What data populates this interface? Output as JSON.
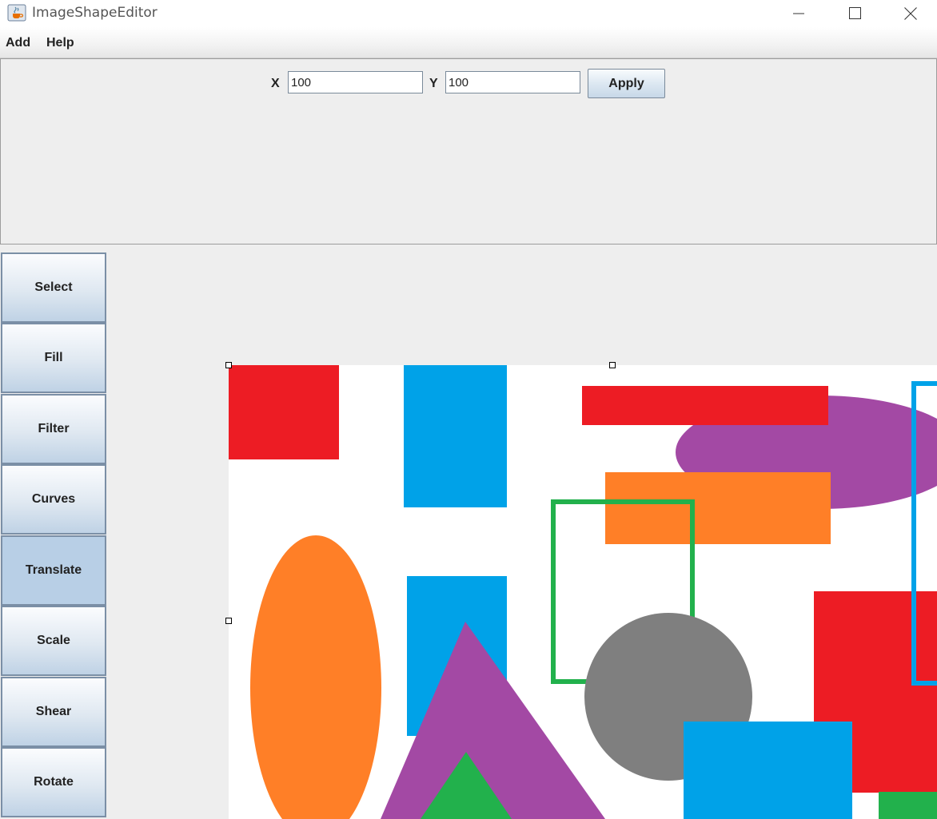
{
  "window": {
    "title": "ImageShapeEditor",
    "app_icon": "java-cup-icon",
    "controls": [
      "minimize-icon",
      "maximize-icon",
      "close-icon"
    ]
  },
  "menubar": {
    "items": [
      {
        "label": "Add"
      },
      {
        "label": "Help"
      }
    ]
  },
  "controls": {
    "x_label": "X",
    "x_value": "100",
    "y_label": "Y",
    "y_value": "100",
    "apply_label": "Apply"
  },
  "tools": {
    "active": "Translate",
    "items": [
      {
        "label": "Select"
      },
      {
        "label": "Fill"
      },
      {
        "label": "Filter"
      },
      {
        "label": "Curves"
      },
      {
        "label": "Translate"
      },
      {
        "label": "Scale"
      },
      {
        "label": "Shear"
      },
      {
        "label": "Rotate"
      }
    ]
  },
  "canvas": {
    "background": "#ffffff",
    "colors": {
      "red": "#ed1c24",
      "blue": "#00a2e8",
      "orange": "#ff7f27",
      "purple": "#a349a4",
      "green": "#22b14c",
      "gray": "#7f7f7f"
    }
  }
}
